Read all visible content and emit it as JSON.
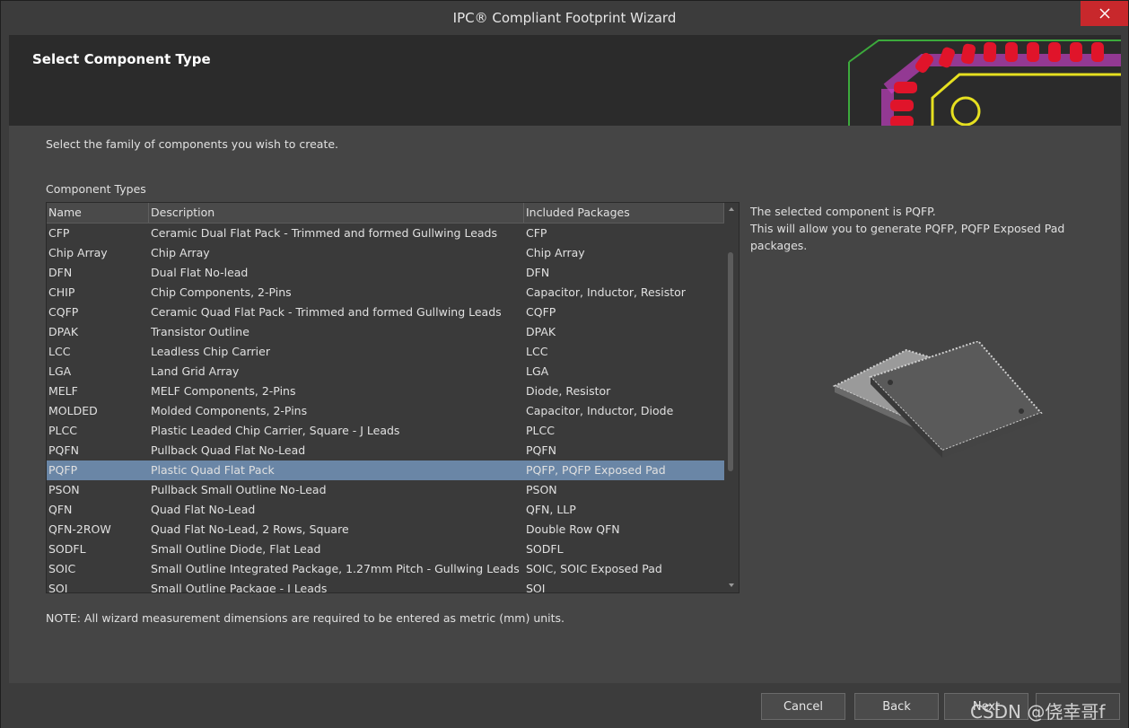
{
  "window": {
    "title": "IPC® Compliant Footprint Wizard"
  },
  "header": {
    "title": "Select Component Type"
  },
  "content": {
    "instruction": "Select the family of components you wish to create.",
    "types_label": "Component Types",
    "note": "NOTE: All wizard measurement dimensions are required to be entered as metric (mm) units."
  },
  "table": {
    "columns": [
      "Name",
      "Description",
      "Included Packages"
    ],
    "selected_index": 12,
    "rows": [
      [
        "CFP",
        "Ceramic Dual Flat Pack - Trimmed and formed Gullwing Leads",
        "CFP"
      ],
      [
        "Chip Array",
        "Chip Array",
        "Chip Array"
      ],
      [
        "DFN",
        "Dual Flat No-lead",
        "DFN"
      ],
      [
        "CHIP",
        "Chip Components, 2-Pins",
        "Capacitor, Inductor, Resistor"
      ],
      [
        "CQFP",
        "Ceramic Quad Flat Pack - Trimmed and formed Gullwing Leads",
        "CQFP"
      ],
      [
        "DPAK",
        "Transistor Outline",
        "DPAK"
      ],
      [
        "LCC",
        "Leadless Chip Carrier",
        "LCC"
      ],
      [
        "LGA",
        "Land Grid Array",
        "LGA"
      ],
      [
        "MELF",
        "MELF Components, 2-Pins",
        "Diode, Resistor"
      ],
      [
        "MOLDED",
        "Molded Components, 2-Pins",
        "Capacitor, Inductor, Diode"
      ],
      [
        "PLCC",
        "Plastic Leaded Chip Carrier, Square - J Leads",
        "PLCC"
      ],
      [
        "PQFN",
        "Pullback Quad Flat No-Lead",
        "PQFN"
      ],
      [
        "PQFP",
        "Plastic Quad Flat Pack",
        "PQFP, PQFP Exposed Pad"
      ],
      [
        "PSON",
        "Pullback Small Outline No-Lead",
        "PSON"
      ],
      [
        "QFN",
        "Quad Flat No-Lead",
        "QFN, LLP"
      ],
      [
        "QFN-2ROW",
        "Quad Flat No-Lead, 2 Rows, Square",
        "Double Row QFN"
      ],
      [
        "SODFL",
        "Small Outline Diode, Flat Lead",
        "SODFL"
      ],
      [
        "SOIC",
        "Small Outline Integrated Package, 1.27mm Pitch - Gullwing Leads",
        "SOIC, SOIC Exposed Pad"
      ],
      [
        "SOJ",
        "Small Outline Package - J Leads",
        "SOJ"
      ]
    ]
  },
  "info": {
    "line1": "The selected component is PQFP.",
    "line2": "This will allow you to generate PQFP, PQFP Exposed Pad packages."
  },
  "buttons": {
    "cancel": "Cancel",
    "back": "Back",
    "next": "Next"
  },
  "watermark": "CSDN @侥幸哥f",
  "colors": {
    "selection": "#6a86a6",
    "close": "#c8282c",
    "pcb_pad": "#e0142a",
    "pcb_outline": "#e6e020"
  }
}
